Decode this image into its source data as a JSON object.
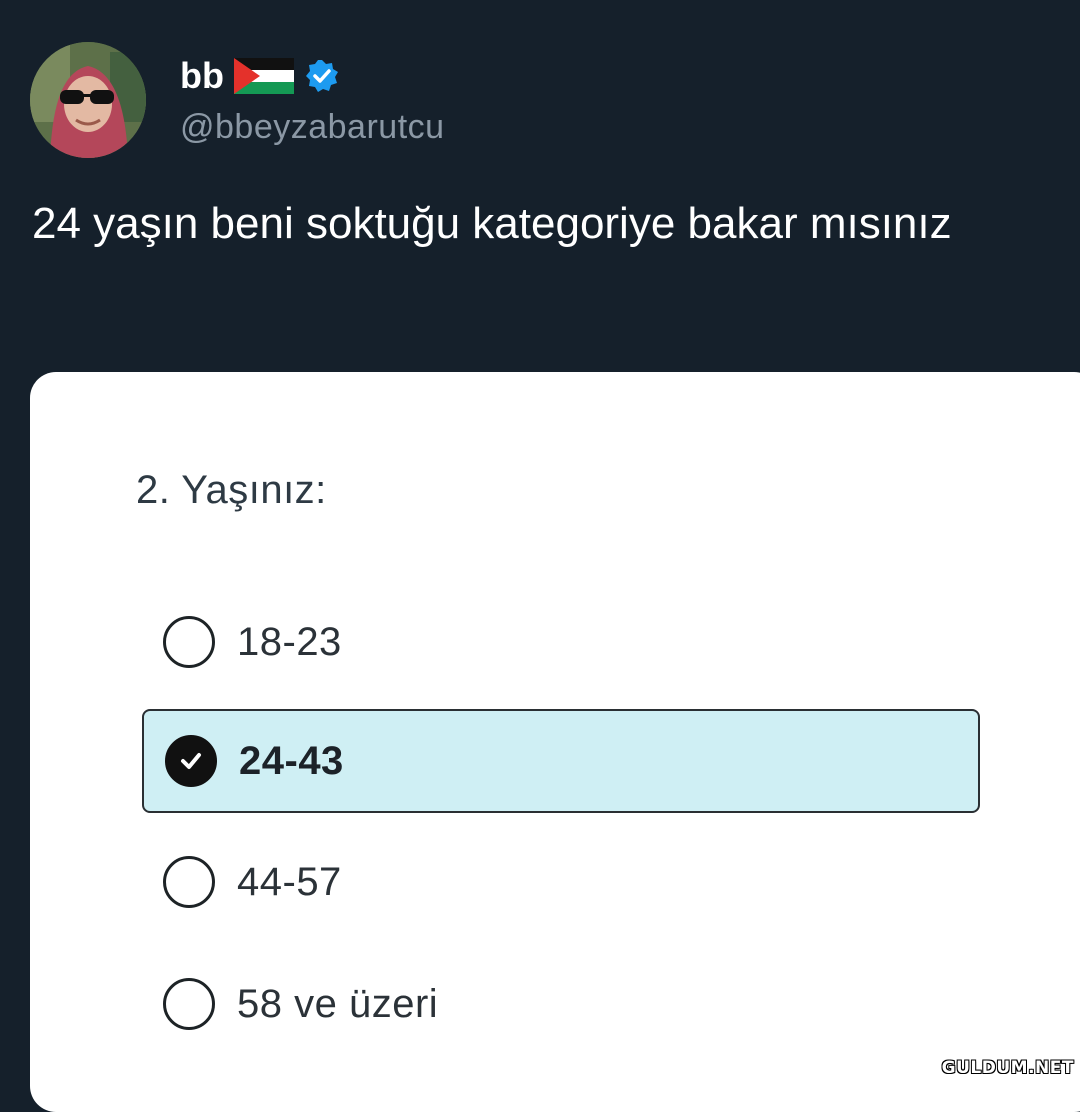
{
  "tweet": {
    "display_name": "bb",
    "handle": "@bbeyzabarutcu",
    "text": "24 yaşın beni soktuğu kategoriye bakar mısınız",
    "flag_icon": "palestine-flag-icon",
    "verified_icon": "verified-badge-icon",
    "verified_color": "#1d9bf0"
  },
  "survey": {
    "question": "2. Yaşınız:",
    "options": [
      {
        "label": "18-23",
        "selected": false
      },
      {
        "label": "24-43",
        "selected": true
      },
      {
        "label": "44-57",
        "selected": false
      },
      {
        "label": "58 ve üzeri",
        "selected": false
      }
    ],
    "selected_bg": "#cfeff4"
  },
  "watermark": "GULDUM.NET"
}
